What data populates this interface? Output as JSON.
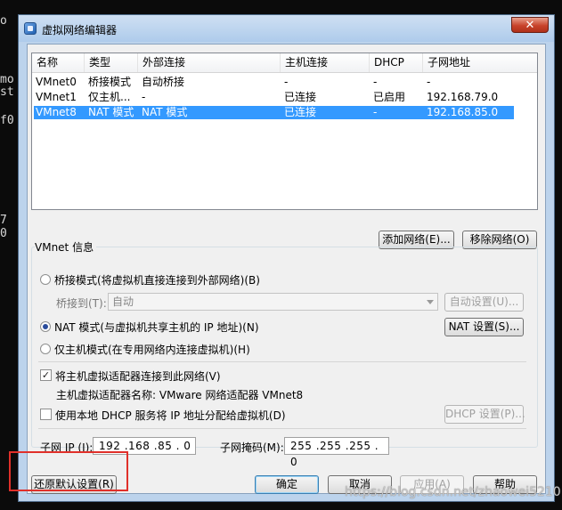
{
  "terminal_fragments": [
    "o",
    "mo",
    "st",
    "f0",
    "7",
    "0"
  ],
  "window": {
    "title": "虚拟网络编辑器",
    "close": "✕"
  },
  "network_list": {
    "columns": [
      "名称",
      "类型",
      "外部连接",
      "主机连接",
      "DHCP",
      "子网地址"
    ],
    "rows": [
      {
        "name": "VMnet0",
        "type": "桥接模式",
        "external": "自动桥接",
        "host": "-",
        "dhcp": "-",
        "subnet": "-"
      },
      {
        "name": "VMnet1",
        "type": "仅主机...",
        "external": "-",
        "host": "已连接",
        "dhcp": "已启用",
        "subnet": "192.168.79.0"
      },
      {
        "name": "VMnet8",
        "type": "NAT 模式",
        "external": "NAT 模式",
        "host": "已连接",
        "dhcp": "-",
        "subnet": "192.168.85.0"
      }
    ],
    "selected_index": 2
  },
  "buttons": {
    "add_network": "添加网络(E)...",
    "remove_network": "移除网络(O)",
    "auto_settings": "自动设置(U)...",
    "nat_settings": "NAT 设置(S)...",
    "dhcp_settings": "DHCP 设置(P)...",
    "restore_defaults": "还原默认设置(R)",
    "ok": "确定",
    "cancel": "取消",
    "apply": "应用(A)",
    "help": "帮助"
  },
  "vmnet_info": {
    "group_label": "VMnet 信息",
    "bridged_label": "桥接模式(将虚拟机直接连接到外部网络)(B)",
    "bridge_to_label": "桥接到(T):",
    "bridge_to_value": "自动",
    "nat_label": "NAT 模式(与虚拟机共享主机的 IP 地址)(N)",
    "host_only_label": "仅主机模式(在专用网络内连接虚拟机)(H)",
    "connect_adapter_label": "将主机虚拟适配器连接到此网络(V)",
    "adapter_name_text": "主机虚拟适配器名称: VMware 网络适配器 VMnet8",
    "dhcp_label": "使用本地 DHCP 服务将 IP 地址分配给虚拟机(D)",
    "mode_selected": "nat",
    "connect_adapter_checked": true,
    "dhcp_checked": false
  },
  "subnet": {
    "ip_label": "子网 IP (I):",
    "ip_value": "192 .168 .85  . 0",
    "mask_label": "子网掩码(M):",
    "mask_value": "255 .255 .255 . 0"
  },
  "watermark": "https://blog.csdn.net/zhaowei5210",
  "colors": {
    "selection": "#3399ff",
    "highlight_box": "#e0302a",
    "window_frame": "#bcd3ec"
  }
}
